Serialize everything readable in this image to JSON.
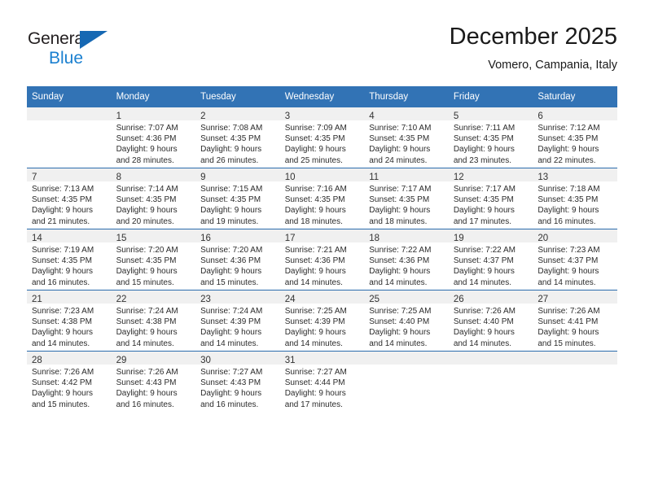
{
  "brand": {
    "line1": "General",
    "line2": "Blue",
    "accent_color": "#1b80d0",
    "triangle_color": "#1668b3"
  },
  "header": {
    "title": "December 2025",
    "subtitle": "Vomero, Campania, Italy"
  },
  "theme": {
    "header_bg": "#3273b5",
    "daynum_bg": "#f0f0f0",
    "row_divider": "#2b6cad"
  },
  "weekdays": [
    "Sunday",
    "Monday",
    "Tuesday",
    "Wednesday",
    "Thursday",
    "Friday",
    "Saturday"
  ],
  "weeks": [
    [
      {
        "day": "",
        "lines": []
      },
      {
        "day": "1",
        "lines": [
          "Sunrise: 7:07 AM",
          "Sunset: 4:36 PM",
          "Daylight: 9 hours",
          "and 28 minutes."
        ]
      },
      {
        "day": "2",
        "lines": [
          "Sunrise: 7:08 AM",
          "Sunset: 4:35 PM",
          "Daylight: 9 hours",
          "and 26 minutes."
        ]
      },
      {
        "day": "3",
        "lines": [
          "Sunrise: 7:09 AM",
          "Sunset: 4:35 PM",
          "Daylight: 9 hours",
          "and 25 minutes."
        ]
      },
      {
        "day": "4",
        "lines": [
          "Sunrise: 7:10 AM",
          "Sunset: 4:35 PM",
          "Daylight: 9 hours",
          "and 24 minutes."
        ]
      },
      {
        "day": "5",
        "lines": [
          "Sunrise: 7:11 AM",
          "Sunset: 4:35 PM",
          "Daylight: 9 hours",
          "and 23 minutes."
        ]
      },
      {
        "day": "6",
        "lines": [
          "Sunrise: 7:12 AM",
          "Sunset: 4:35 PM",
          "Daylight: 9 hours",
          "and 22 minutes."
        ]
      }
    ],
    [
      {
        "day": "7",
        "lines": [
          "Sunrise: 7:13 AM",
          "Sunset: 4:35 PM",
          "Daylight: 9 hours",
          "and 21 minutes."
        ]
      },
      {
        "day": "8",
        "lines": [
          "Sunrise: 7:14 AM",
          "Sunset: 4:35 PM",
          "Daylight: 9 hours",
          "and 20 minutes."
        ]
      },
      {
        "day": "9",
        "lines": [
          "Sunrise: 7:15 AM",
          "Sunset: 4:35 PM",
          "Daylight: 9 hours",
          "and 19 minutes."
        ]
      },
      {
        "day": "10",
        "lines": [
          "Sunrise: 7:16 AM",
          "Sunset: 4:35 PM",
          "Daylight: 9 hours",
          "and 18 minutes."
        ]
      },
      {
        "day": "11",
        "lines": [
          "Sunrise: 7:17 AM",
          "Sunset: 4:35 PM",
          "Daylight: 9 hours",
          "and 18 minutes."
        ]
      },
      {
        "day": "12",
        "lines": [
          "Sunrise: 7:17 AM",
          "Sunset: 4:35 PM",
          "Daylight: 9 hours",
          "and 17 minutes."
        ]
      },
      {
        "day": "13",
        "lines": [
          "Sunrise: 7:18 AM",
          "Sunset: 4:35 PM",
          "Daylight: 9 hours",
          "and 16 minutes."
        ]
      }
    ],
    [
      {
        "day": "14",
        "lines": [
          "Sunrise: 7:19 AM",
          "Sunset: 4:35 PM",
          "Daylight: 9 hours",
          "and 16 minutes."
        ]
      },
      {
        "day": "15",
        "lines": [
          "Sunrise: 7:20 AM",
          "Sunset: 4:35 PM",
          "Daylight: 9 hours",
          "and 15 minutes."
        ]
      },
      {
        "day": "16",
        "lines": [
          "Sunrise: 7:20 AM",
          "Sunset: 4:36 PM",
          "Daylight: 9 hours",
          "and 15 minutes."
        ]
      },
      {
        "day": "17",
        "lines": [
          "Sunrise: 7:21 AM",
          "Sunset: 4:36 PM",
          "Daylight: 9 hours",
          "and 14 minutes."
        ]
      },
      {
        "day": "18",
        "lines": [
          "Sunrise: 7:22 AM",
          "Sunset: 4:36 PM",
          "Daylight: 9 hours",
          "and 14 minutes."
        ]
      },
      {
        "day": "19",
        "lines": [
          "Sunrise: 7:22 AM",
          "Sunset: 4:37 PM",
          "Daylight: 9 hours",
          "and 14 minutes."
        ]
      },
      {
        "day": "20",
        "lines": [
          "Sunrise: 7:23 AM",
          "Sunset: 4:37 PM",
          "Daylight: 9 hours",
          "and 14 minutes."
        ]
      }
    ],
    [
      {
        "day": "21",
        "lines": [
          "Sunrise: 7:23 AM",
          "Sunset: 4:38 PM",
          "Daylight: 9 hours",
          "and 14 minutes."
        ]
      },
      {
        "day": "22",
        "lines": [
          "Sunrise: 7:24 AM",
          "Sunset: 4:38 PM",
          "Daylight: 9 hours",
          "and 14 minutes."
        ]
      },
      {
        "day": "23",
        "lines": [
          "Sunrise: 7:24 AM",
          "Sunset: 4:39 PM",
          "Daylight: 9 hours",
          "and 14 minutes."
        ]
      },
      {
        "day": "24",
        "lines": [
          "Sunrise: 7:25 AM",
          "Sunset: 4:39 PM",
          "Daylight: 9 hours",
          "and 14 minutes."
        ]
      },
      {
        "day": "25",
        "lines": [
          "Sunrise: 7:25 AM",
          "Sunset: 4:40 PM",
          "Daylight: 9 hours",
          "and 14 minutes."
        ]
      },
      {
        "day": "26",
        "lines": [
          "Sunrise: 7:26 AM",
          "Sunset: 4:40 PM",
          "Daylight: 9 hours",
          "and 14 minutes."
        ]
      },
      {
        "day": "27",
        "lines": [
          "Sunrise: 7:26 AM",
          "Sunset: 4:41 PM",
          "Daylight: 9 hours",
          "and 15 minutes."
        ]
      }
    ],
    [
      {
        "day": "28",
        "lines": [
          "Sunrise: 7:26 AM",
          "Sunset: 4:42 PM",
          "Daylight: 9 hours",
          "and 15 minutes."
        ]
      },
      {
        "day": "29",
        "lines": [
          "Sunrise: 7:26 AM",
          "Sunset: 4:43 PM",
          "Daylight: 9 hours",
          "and 16 minutes."
        ]
      },
      {
        "day": "30",
        "lines": [
          "Sunrise: 7:27 AM",
          "Sunset: 4:43 PM",
          "Daylight: 9 hours",
          "and 16 minutes."
        ]
      },
      {
        "day": "31",
        "lines": [
          "Sunrise: 7:27 AM",
          "Sunset: 4:44 PM",
          "Daylight: 9 hours",
          "and 17 minutes."
        ]
      },
      {
        "day": "",
        "lines": []
      },
      {
        "day": "",
        "lines": []
      },
      {
        "day": "",
        "lines": []
      }
    ]
  ]
}
